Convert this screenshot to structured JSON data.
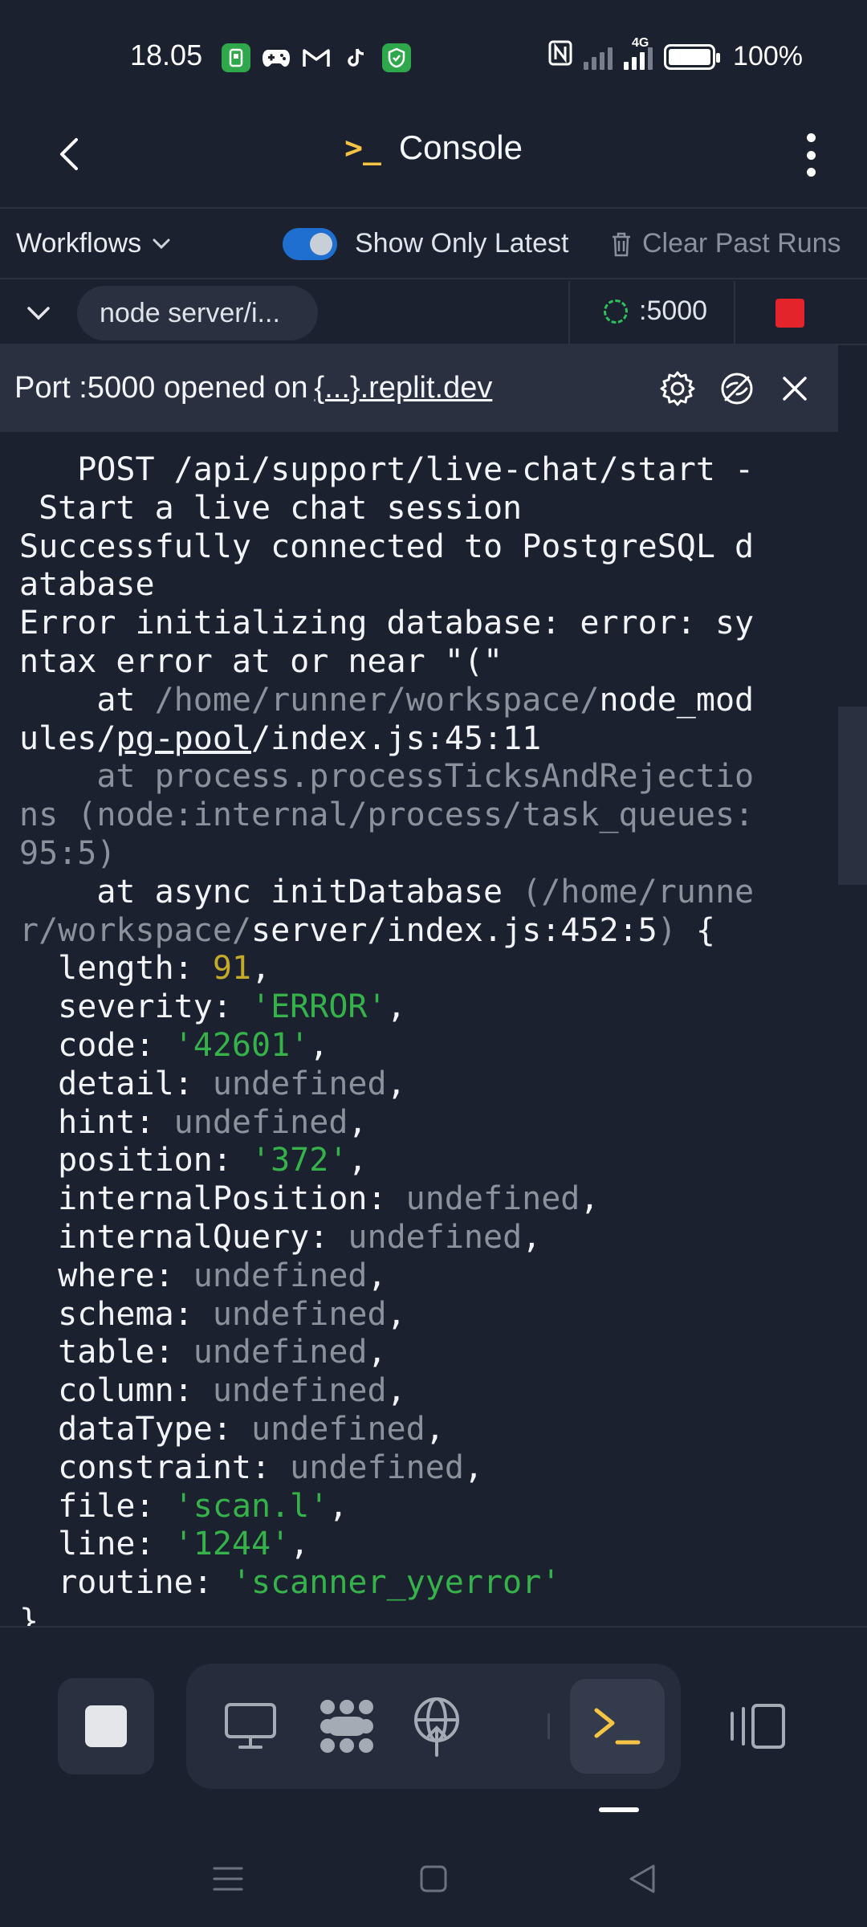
{
  "status_bar": {
    "time": "18.05",
    "battery": "100%",
    "network": "4G",
    "app_icons": [
      "android-auto-icon",
      "gamepad-icon",
      "gmail-icon",
      "tiktok-icon",
      "shield-app-icon"
    ]
  },
  "header": {
    "title": "Console",
    "title_icon": ">_"
  },
  "toolbar": {
    "workflows_label": "Workflows",
    "show_latest_label": "Show Only Latest",
    "show_latest_on": true,
    "clear_label": "Clear Past Runs"
  },
  "process": {
    "command": "node server/i...",
    "port": ":5000"
  },
  "port_banner": {
    "prefix": "Port :5000 opened on",
    "link": "{...}.replit.dev"
  },
  "console": {
    "l1": "   POST /api/support/live-chat/start -",
    "l2": " Start a live chat session",
    "l3": "Successfully connected to PostgreSQL d",
    "l4": "atabase",
    "l5": "Error initializing database: error: sy",
    "l6": "ntax error at or near \"(\"",
    "l7a": "    at ",
    "l7b": "/home/runner/workspace/",
    "l7c": "node_mod",
    "l8a": "ules/",
    "l8b": "pg-pool",
    "l8c": "/index.js:45:11",
    "l9": "    at process.processTicksAndRejectio",
    "l10": "ns (node:internal/process/task_queues:",
    "l11": "95:5)",
    "l12a": "    at async initDatabase ",
    "l12b": "(/home/runne",
    "l13a": "r/workspace/",
    "l13b": "server/index.js:452:5",
    "l13c": ") ",
    "l13d": "{",
    "fields": [
      {
        "k": "  length: ",
        "v": "91",
        "t": "num",
        "e": ","
      },
      {
        "k": "  severity: ",
        "v": "'ERROR'",
        "t": "str",
        "e": ","
      },
      {
        "k": "  code: ",
        "v": "'42601'",
        "t": "str",
        "e": ","
      },
      {
        "k": "  detail: ",
        "v": "undefined",
        "t": "dim",
        "e": ","
      },
      {
        "k": "  hint: ",
        "v": "undefined",
        "t": "dim",
        "e": ","
      },
      {
        "k": "  position: ",
        "v": "'372'",
        "t": "str",
        "e": ","
      },
      {
        "k": "  internalPosition: ",
        "v": "undefined",
        "t": "dim",
        "e": ","
      },
      {
        "k": "  internalQuery: ",
        "v": "undefined",
        "t": "dim",
        "e": ","
      },
      {
        "k": "  where: ",
        "v": "undefined",
        "t": "dim",
        "e": ","
      },
      {
        "k": "  schema: ",
        "v": "undefined",
        "t": "dim",
        "e": ","
      },
      {
        "k": "  table: ",
        "v": "undefined",
        "t": "dim",
        "e": ","
      },
      {
        "k": "  column: ",
        "v": "undefined",
        "t": "dim",
        "e": ","
      },
      {
        "k": "  dataType: ",
        "v": "undefined",
        "t": "dim",
        "e": ","
      },
      {
        "k": "  constraint: ",
        "v": "undefined",
        "t": "dim",
        "e": ","
      },
      {
        "k": "  file: ",
        "v": "'scan.l'",
        "t": "str",
        "e": ","
      },
      {
        "k": "  line: ",
        "v": "'1244'",
        "t": "str",
        "e": ","
      },
      {
        "k": "  routine: ",
        "v": "'scanner_yyerror'",
        "t": "str",
        "e": ""
      }
    ],
    "closing": "}"
  },
  "colors": {
    "background": "#1c2130",
    "accent_yellow": "#f6c445",
    "stop_red": "#e3242b",
    "toggle_blue": "#1f6fd1",
    "number": "#c4a92a",
    "string": "#36b24a",
    "dim": "#8c929c"
  },
  "dock": {
    "icons": [
      "stop-icon",
      "monitor-icon",
      "cluster-icon",
      "network-globe-icon",
      "console-icon",
      "panels-icon"
    ]
  }
}
